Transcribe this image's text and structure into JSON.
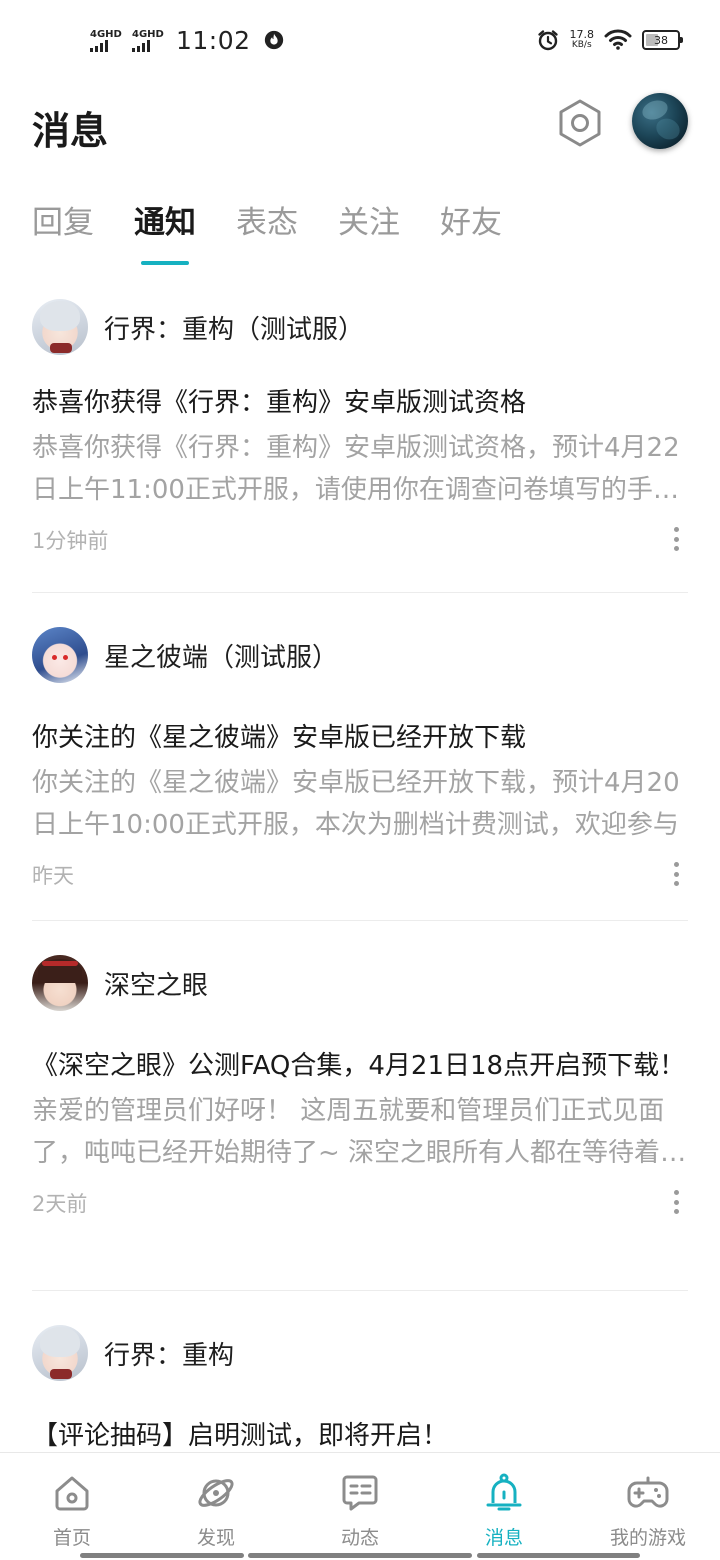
{
  "status_bar": {
    "net1": "4GHD",
    "net2": "4GHD",
    "time": "11:02",
    "speed_value": "17.8",
    "speed_unit": "KB/s",
    "battery": "38",
    "battery_level": 0.38
  },
  "header": {
    "title": "消息",
    "settings_icon": "hexagon-settings-icon",
    "avatar_icon": "user-avatar"
  },
  "tabs": [
    {
      "label": "回复",
      "active": false
    },
    {
      "label": "通知",
      "active": true
    },
    {
      "label": "表态",
      "active": false
    },
    {
      "label": "关注",
      "active": false
    },
    {
      "label": "好友",
      "active": false
    }
  ],
  "feed": [
    {
      "author": "行界：重构（测试服）",
      "title": "恭喜你获得《行界：重构》安卓版测试资格",
      "body": "恭喜你获得《行界：重构》安卓版测试资格，预计4月22日上午11:00正式开服，请使用你在调查问卷填写的手机号登录",
      "time": "1分钟前"
    },
    {
      "author": "星之彼端（测试服）",
      "title": "你关注的《星之彼端》安卓版已经开放下载",
      "body": "你关注的《星之彼端》安卓版已经开放下载，预计4月20日上午10:00正式开服，本次为删档计费测试，欢迎参与",
      "time": "昨天"
    },
    {
      "author": "深空之眼",
      "title": "《深空之眼》公测FAQ合集，4月21日18点开启预下载！",
      "body": "亲爱的管理员们好呀！ 这周五就要和管理员们正式见面了，吨吨已经开始期待了~ 深空之眼所有人都在等待着你们",
      "time": "2天前"
    },
    {
      "author": "行界：重构",
      "title": "【评论抽码】启明测试，即将开启！",
      "body": "",
      "time": ""
    }
  ],
  "bottom_nav": [
    {
      "label": "首页",
      "icon": "home-icon",
      "active": false
    },
    {
      "label": "发现",
      "icon": "planet-icon",
      "active": false
    },
    {
      "label": "动态",
      "icon": "chat-bubble-icon",
      "active": false
    },
    {
      "label": "消息",
      "icon": "bell-icon",
      "active": true
    },
    {
      "label": "我的游戏",
      "icon": "gamepad-icon",
      "active": false
    }
  ],
  "colors": {
    "accent": "#16b1c1",
    "text_primary": "#1a1a1a",
    "text_secondary": "#a3a3a3",
    "nav_inactive": "#8c8c8c"
  }
}
